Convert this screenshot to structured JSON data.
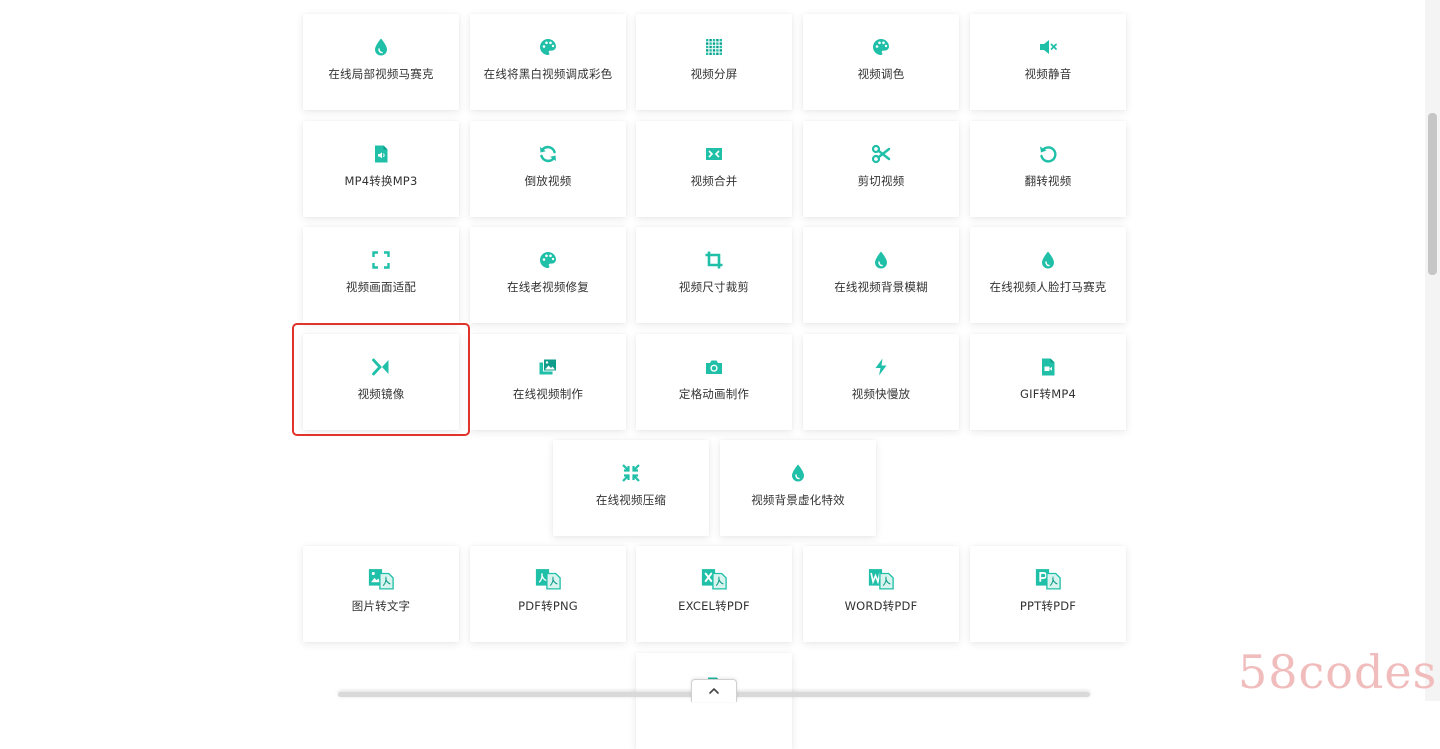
{
  "colors": {
    "accent": "#1fbfa8",
    "accent_dark": "#0f9c8a",
    "highlight": "#e0332b"
  },
  "tools": [
    {
      "label": "在线局部视频马赛克",
      "icon": "drop-icon"
    },
    {
      "label": "在线将黑白视频调成彩色",
      "icon": "palette-icon"
    },
    {
      "label": "视频分屏",
      "icon": "grid-icon"
    },
    {
      "label": "视频调色",
      "icon": "palette-icon"
    },
    {
      "label": "视频静音",
      "icon": "mute-icon"
    },
    {
      "label": "MP4转换MP3",
      "icon": "audio-file-icon"
    },
    {
      "label": "倒放视频",
      "icon": "refresh-icon"
    },
    {
      "label": "视频合并",
      "icon": "merge-icon"
    },
    {
      "label": "剪切视频",
      "icon": "scissors-icon"
    },
    {
      "label": "翻转视频",
      "icon": "undo-icon"
    },
    {
      "label": "视频画面适配",
      "icon": "expand-icon"
    },
    {
      "label": "在线老视频修复",
      "icon": "palette-icon"
    },
    {
      "label": "视频尺寸裁剪",
      "icon": "crop-icon"
    },
    {
      "label": "在线视频背景模糊",
      "icon": "drop-icon"
    },
    {
      "label": "在线视频人脸打马赛克",
      "icon": "drop-icon"
    },
    {
      "label": "视频镜像",
      "icon": "mirror-icon"
    },
    {
      "label": "在线视频制作",
      "icon": "images-icon"
    },
    {
      "label": "定格动画制作",
      "icon": "camera-icon"
    },
    {
      "label": "视频快慢放",
      "icon": "bolt-icon"
    },
    {
      "label": "GIF转MP4",
      "icon": "video-file-icon"
    },
    {
      "label": "在线视频压缩",
      "icon": "compress-icon"
    },
    {
      "label": "视频背景虚化特效",
      "icon": "drop-icon"
    },
    {
      "label": "图片转文字",
      "icon": "image-to-doc-icon"
    },
    {
      "label": "PDF转PNG",
      "icon": "pdf-to-image-icon"
    },
    {
      "label": "EXCEL转PDF",
      "icon": "excel-to-pdf-icon"
    },
    {
      "label": "WORD转PDF",
      "icon": "word-to-pdf-icon"
    },
    {
      "label": "PPT转PDF",
      "icon": "ppt-to-pdf-icon"
    },
    {
      "label": "",
      "icon": "document-icon"
    }
  ],
  "watermark": "58codes"
}
